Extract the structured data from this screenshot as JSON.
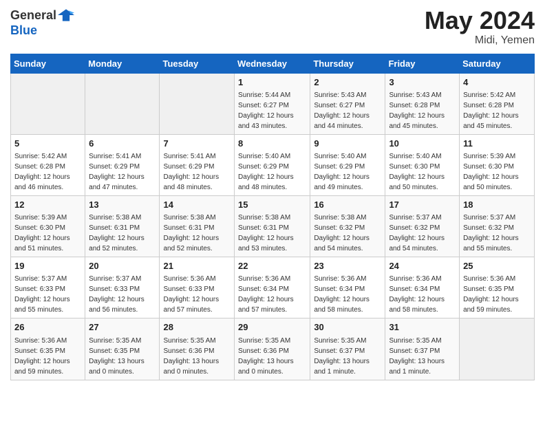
{
  "header": {
    "logo_general": "General",
    "logo_blue": "Blue",
    "month_year": "May 2024",
    "location": "Midi, Yemen"
  },
  "days_of_week": [
    "Sunday",
    "Monday",
    "Tuesday",
    "Wednesday",
    "Thursday",
    "Friday",
    "Saturday"
  ],
  "weeks": [
    [
      {
        "day": "",
        "info": ""
      },
      {
        "day": "",
        "info": ""
      },
      {
        "day": "",
        "info": ""
      },
      {
        "day": "1",
        "info": "Sunrise: 5:44 AM\nSunset: 6:27 PM\nDaylight: 12 hours\nand 43 minutes."
      },
      {
        "day": "2",
        "info": "Sunrise: 5:43 AM\nSunset: 6:27 PM\nDaylight: 12 hours\nand 44 minutes."
      },
      {
        "day": "3",
        "info": "Sunrise: 5:43 AM\nSunset: 6:28 PM\nDaylight: 12 hours\nand 45 minutes."
      },
      {
        "day": "4",
        "info": "Sunrise: 5:42 AM\nSunset: 6:28 PM\nDaylight: 12 hours\nand 45 minutes."
      }
    ],
    [
      {
        "day": "5",
        "info": "Sunrise: 5:42 AM\nSunset: 6:28 PM\nDaylight: 12 hours\nand 46 minutes."
      },
      {
        "day": "6",
        "info": "Sunrise: 5:41 AM\nSunset: 6:29 PM\nDaylight: 12 hours\nand 47 minutes."
      },
      {
        "day": "7",
        "info": "Sunrise: 5:41 AM\nSunset: 6:29 PM\nDaylight: 12 hours\nand 48 minutes."
      },
      {
        "day": "8",
        "info": "Sunrise: 5:40 AM\nSunset: 6:29 PM\nDaylight: 12 hours\nand 48 minutes."
      },
      {
        "day": "9",
        "info": "Sunrise: 5:40 AM\nSunset: 6:29 PM\nDaylight: 12 hours\nand 49 minutes."
      },
      {
        "day": "10",
        "info": "Sunrise: 5:40 AM\nSunset: 6:30 PM\nDaylight: 12 hours\nand 50 minutes."
      },
      {
        "day": "11",
        "info": "Sunrise: 5:39 AM\nSunset: 6:30 PM\nDaylight: 12 hours\nand 50 minutes."
      }
    ],
    [
      {
        "day": "12",
        "info": "Sunrise: 5:39 AM\nSunset: 6:30 PM\nDaylight: 12 hours\nand 51 minutes."
      },
      {
        "day": "13",
        "info": "Sunrise: 5:38 AM\nSunset: 6:31 PM\nDaylight: 12 hours\nand 52 minutes."
      },
      {
        "day": "14",
        "info": "Sunrise: 5:38 AM\nSunset: 6:31 PM\nDaylight: 12 hours\nand 52 minutes."
      },
      {
        "day": "15",
        "info": "Sunrise: 5:38 AM\nSunset: 6:31 PM\nDaylight: 12 hours\nand 53 minutes."
      },
      {
        "day": "16",
        "info": "Sunrise: 5:38 AM\nSunset: 6:32 PM\nDaylight: 12 hours\nand 54 minutes."
      },
      {
        "day": "17",
        "info": "Sunrise: 5:37 AM\nSunset: 6:32 PM\nDaylight: 12 hours\nand 54 minutes."
      },
      {
        "day": "18",
        "info": "Sunrise: 5:37 AM\nSunset: 6:32 PM\nDaylight: 12 hours\nand 55 minutes."
      }
    ],
    [
      {
        "day": "19",
        "info": "Sunrise: 5:37 AM\nSunset: 6:33 PM\nDaylight: 12 hours\nand 55 minutes."
      },
      {
        "day": "20",
        "info": "Sunrise: 5:37 AM\nSunset: 6:33 PM\nDaylight: 12 hours\nand 56 minutes."
      },
      {
        "day": "21",
        "info": "Sunrise: 5:36 AM\nSunset: 6:33 PM\nDaylight: 12 hours\nand 57 minutes."
      },
      {
        "day": "22",
        "info": "Sunrise: 5:36 AM\nSunset: 6:34 PM\nDaylight: 12 hours\nand 57 minutes."
      },
      {
        "day": "23",
        "info": "Sunrise: 5:36 AM\nSunset: 6:34 PM\nDaylight: 12 hours\nand 58 minutes."
      },
      {
        "day": "24",
        "info": "Sunrise: 5:36 AM\nSunset: 6:34 PM\nDaylight: 12 hours\nand 58 minutes."
      },
      {
        "day": "25",
        "info": "Sunrise: 5:36 AM\nSunset: 6:35 PM\nDaylight: 12 hours\nand 59 minutes."
      }
    ],
    [
      {
        "day": "26",
        "info": "Sunrise: 5:36 AM\nSunset: 6:35 PM\nDaylight: 12 hours\nand 59 minutes."
      },
      {
        "day": "27",
        "info": "Sunrise: 5:35 AM\nSunset: 6:35 PM\nDaylight: 13 hours\nand 0 minutes."
      },
      {
        "day": "28",
        "info": "Sunrise: 5:35 AM\nSunset: 6:36 PM\nDaylight: 13 hours\nand 0 minutes."
      },
      {
        "day": "29",
        "info": "Sunrise: 5:35 AM\nSunset: 6:36 PM\nDaylight: 13 hours\nand 0 minutes."
      },
      {
        "day": "30",
        "info": "Sunrise: 5:35 AM\nSunset: 6:37 PM\nDaylight: 13 hours\nand 1 minute."
      },
      {
        "day": "31",
        "info": "Sunrise: 5:35 AM\nSunset: 6:37 PM\nDaylight: 13 hours\nand 1 minute."
      },
      {
        "day": "",
        "info": ""
      }
    ]
  ]
}
